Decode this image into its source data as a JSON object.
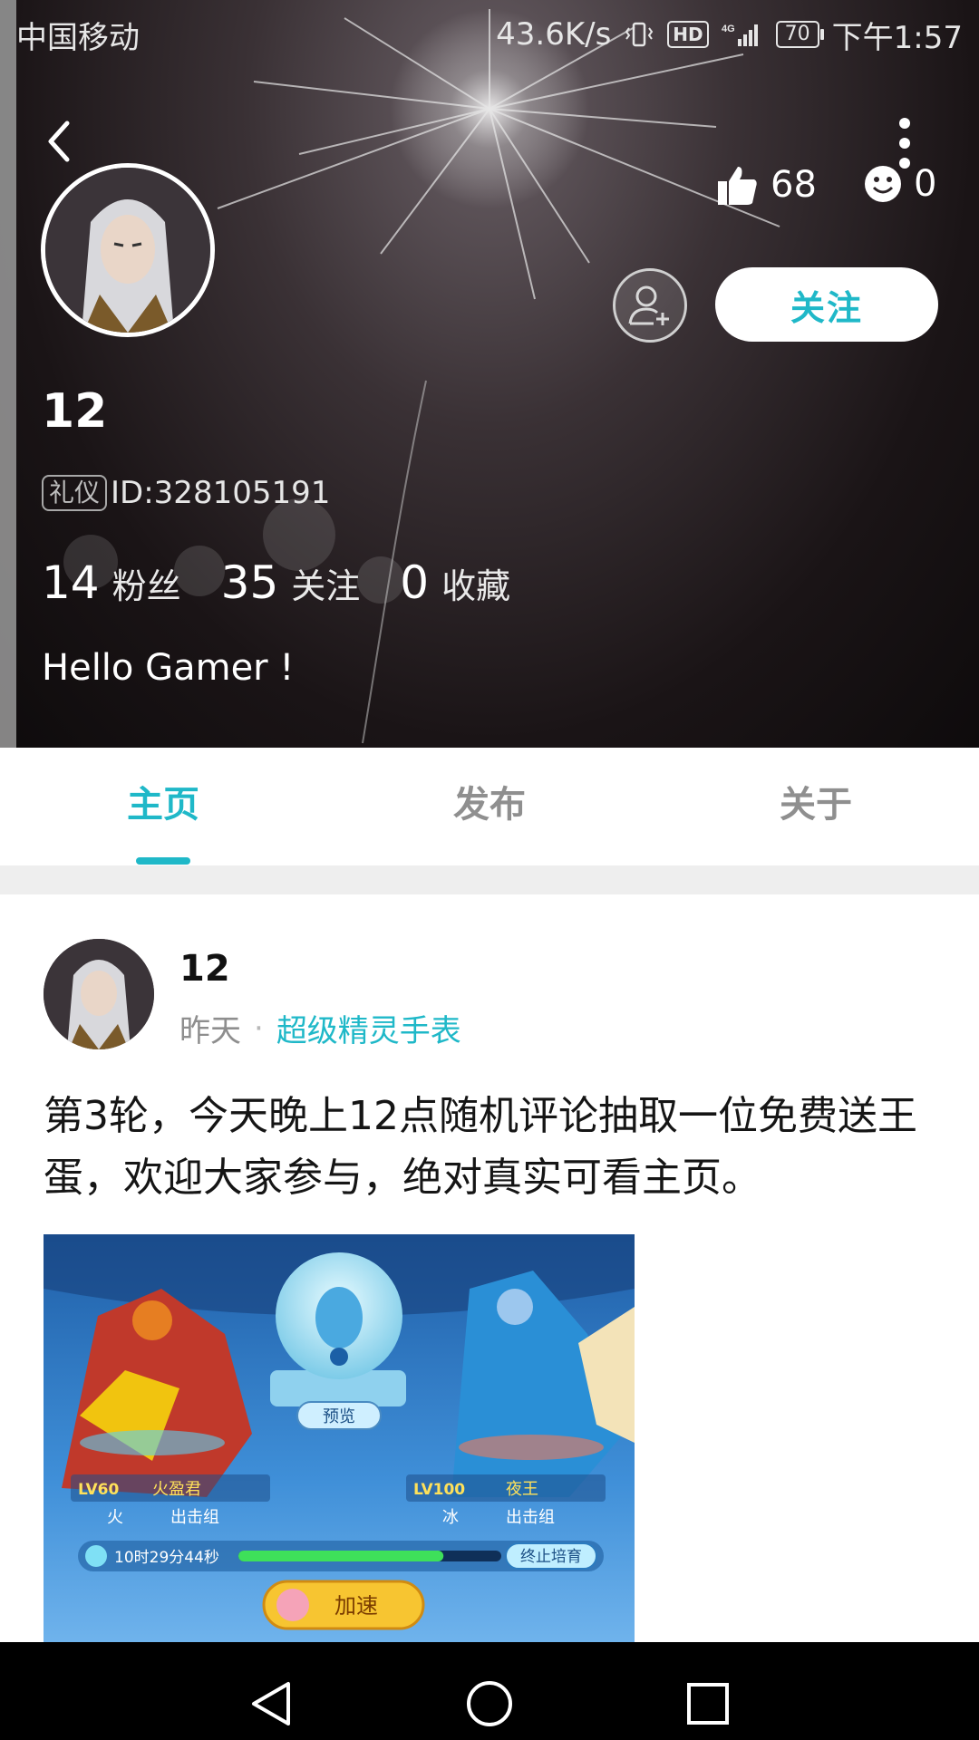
{
  "status_bar": {
    "carrier": "中国移动",
    "speed": "43.6K/s",
    "hd": "HD",
    "network": "4G",
    "battery": "70",
    "time": "下午1:57"
  },
  "profile": {
    "likes": "68",
    "faces": "0",
    "follow_label": "关注",
    "username": "12",
    "tag": "礼仪",
    "id_text": "ID:328105191",
    "stats": [
      {
        "num": "14",
        "label": "粉丝"
      },
      {
        "num": "35",
        "label": "关注"
      },
      {
        "num": "0",
        "label": "收藏"
      }
    ],
    "bio": "Hello Gamer !"
  },
  "tabs": [
    {
      "label": "主页",
      "active": true
    },
    {
      "label": "发布",
      "active": false
    },
    {
      "label": "关于",
      "active": false
    }
  ],
  "post": {
    "username": "12",
    "time": "昨天",
    "separator": "·",
    "topic": "超级精灵手表",
    "text": "第3轮，今天晚上12点随机评论抽取一位免费送王蛋，欢迎大家参与，绝对真实可看主页。",
    "image": {
      "preview_label": "预览",
      "left_level": "LV60",
      "left_name": "火盈君",
      "left_attr": "火",
      "left_group": "出击组",
      "right_level": "LV100",
      "right_name": "夜王",
      "right_attr": "冰",
      "right_group": "出击组",
      "timer": "10时29分44秒",
      "timer_progress": 0.78,
      "stop_label": "终止培育",
      "speed_label": "加速"
    }
  },
  "colors": {
    "accent": "#1fb8c8",
    "header_bg": "#1a1416",
    "nav_bg": "#000000"
  }
}
